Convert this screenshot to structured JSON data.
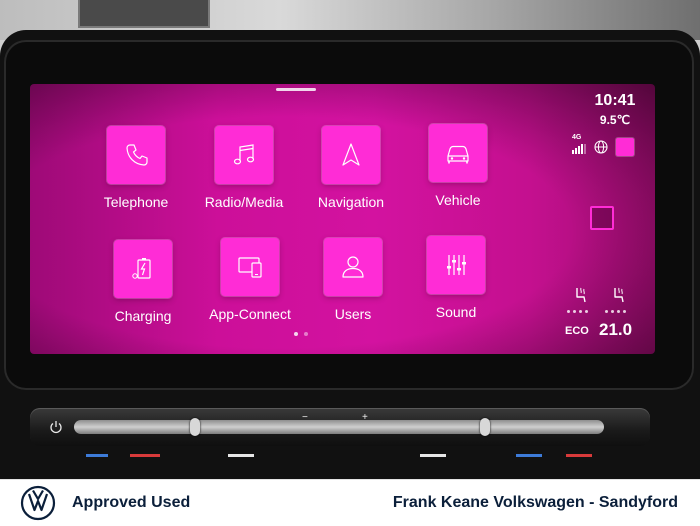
{
  "screen": {
    "apps": [
      {
        "id": "telephone",
        "label": "Telephone",
        "icon": "phone-icon"
      },
      {
        "id": "radio-media",
        "label": "Radio/Media",
        "icon": "music-note-icon"
      },
      {
        "id": "navigation",
        "label": "Navigation",
        "icon": "navigation-arrow-icon"
      },
      {
        "id": "vehicle",
        "label": "Vehicle",
        "icon": "car-icon"
      },
      {
        "id": "charging",
        "label": "Charging",
        "icon": "battery-charging-icon"
      },
      {
        "id": "app-connect",
        "label": "App-Connect",
        "icon": "phone-mirror-icon"
      },
      {
        "id": "users",
        "label": "Users",
        "icon": "user-icon"
      },
      {
        "id": "sound",
        "label": "Sound",
        "icon": "equalizer-sliders-icon"
      }
    ],
    "page_indicator": {
      "pages": 2,
      "current": 1
    }
  },
  "status": {
    "time": "10:41",
    "outside_temp": "9.5℃",
    "network": "4G",
    "signal_bars": 4
  },
  "climate": {
    "mode": "ECO",
    "temperature": "21.0"
  },
  "dealer": {
    "tagline": "Approved Used",
    "name": "Frank Keane Volkswagen - Sandyford",
    "brand_color": "#0b1f3a"
  },
  "colors": {
    "screen_background": "#cc0f99",
    "tile_background": "#ff2cd6"
  }
}
